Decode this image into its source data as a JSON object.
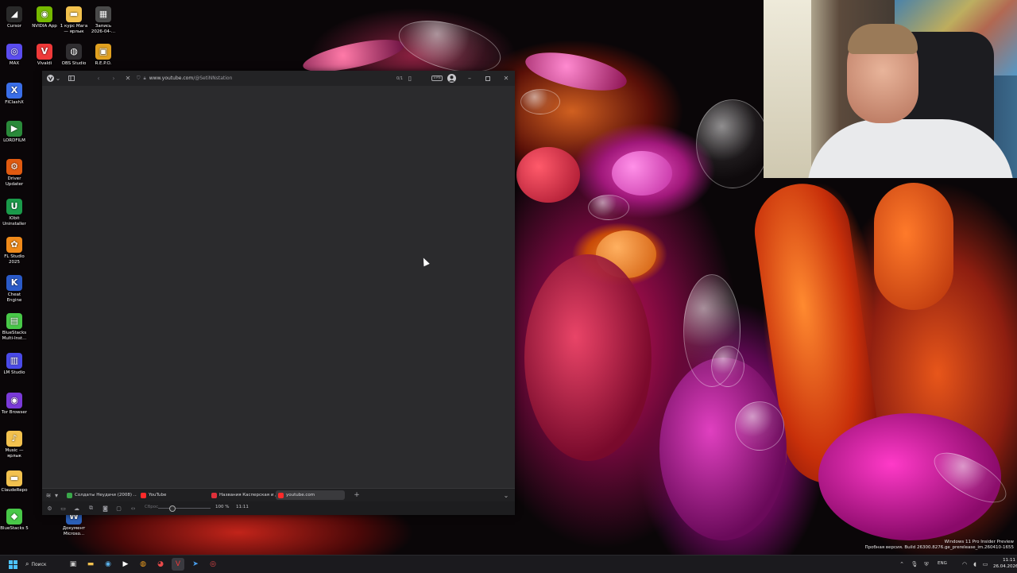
{
  "desktop_icons": [
    {
      "label": "Cursor",
      "icon": "cursor-app-icon",
      "color": "#2a2a2a",
      "glyph": "◢"
    },
    {
      "label": "NVIDIA App",
      "icon": "nvidia-icon",
      "color": "#76b900",
      "glyph": "◉"
    },
    {
      "label": "1 курс Мага — ярлык",
      "icon": "folder-icon",
      "color": "#f2c14e",
      "glyph": "▬"
    },
    {
      "label": "Запись 2026-04-...",
      "icon": "video-file-icon",
      "color": "#4a4a4a",
      "glyph": "▦"
    },
    {
      "label": "MAX",
      "icon": "max-app-icon",
      "color": "#5a4cf0",
      "glyph": "◎"
    },
    {
      "label": "Vivaldi",
      "icon": "vivaldi-icon",
      "color": "#ef3939",
      "glyph": "V"
    },
    {
      "label": "OBS Studio",
      "icon": "obs-icon",
      "color": "#302e31",
      "glyph": "◍"
    },
    {
      "label": "R.E.P.O.",
      "icon": "repo-game-icon",
      "color": "#e0a020",
      "glyph": "▣"
    },
    {
      "label": "FlClashX",
      "icon": "flclashx-icon",
      "color": "#3a6ee8",
      "glyph": "X"
    },
    {
      "label": "LORDFILM",
      "icon": "lordfilm-icon",
      "color": "#2a8a3a",
      "glyph": "▶"
    },
    {
      "label": "Driver Updater",
      "icon": "driver-updater-icon",
      "color": "#e05a10",
      "glyph": "⚙"
    },
    {
      "label": "IObit Uninstaller",
      "icon": "uninstaller-icon",
      "color": "#1a9a4a",
      "glyph": "U"
    },
    {
      "label": "FL Studio 2025",
      "icon": "fl-studio-icon",
      "color": "#f08a1a",
      "glyph": "✿"
    },
    {
      "label": "Cheat Engine",
      "icon": "cheat-engine-icon",
      "color": "#2a5ac8",
      "glyph": "K"
    },
    {
      "label": "BlueStacks Multi-Inst...",
      "icon": "bluestacks-icon",
      "color": "#48c848",
      "glyph": "▤"
    },
    {
      "label": "LM Studio",
      "icon": "lm-studio-icon",
      "color": "#4a4ae8",
      "glyph": "▥"
    },
    {
      "label": "Tor Browser",
      "icon": "tor-browser-icon",
      "color": "#7a3ad8",
      "glyph": "◉"
    },
    {
      "label": "Music — ярлык",
      "icon": "music-folder-icon",
      "color": "#f2c14e",
      "glyph": "♪"
    },
    {
      "label": "ClaudeRepo",
      "icon": "claude-folder-icon",
      "color": "#f2c14e",
      "glyph": "▬"
    },
    {
      "label": "BlueStacks 5",
      "icon": "bluestacks5-icon",
      "color": "#48c848",
      "glyph": "◆"
    },
    {
      "label": "Документ Microso...",
      "icon": "word-doc-icon",
      "color": "#2b5fb8",
      "glyph": "W"
    }
  ],
  "browser": {
    "url_host": "www.youtube.com",
    "url_path": "/@SetiNNstation",
    "page_counter": "0/1",
    "vpn_label": "VPN",
    "tabs": [
      {
        "label": "Солдаты Неудачи (2008) ...",
        "color": "#3aa84a"
      },
      {
        "label": "YouTube",
        "color": "#ff2a2a"
      },
      {
        "label": "Названия Касперская и дис...",
        "color": "#e0303a"
      },
      {
        "label": "youtube.com",
        "color": "#ff2a2a"
      }
    ],
    "status": {
      "reset_label": "Сброс",
      "zoom": "100 %",
      "time": "11:11"
    }
  },
  "taskbar": {
    "search_label": "Поиск",
    "lang": "ENG",
    "time": "11:11",
    "date": "26.04.2026"
  },
  "watermark": {
    "line1": "Windows 11 Pro Insider Preview",
    "line2": "Пробная версия. Build 26300.8276.ge_prerelease_im.260410-1655"
  }
}
